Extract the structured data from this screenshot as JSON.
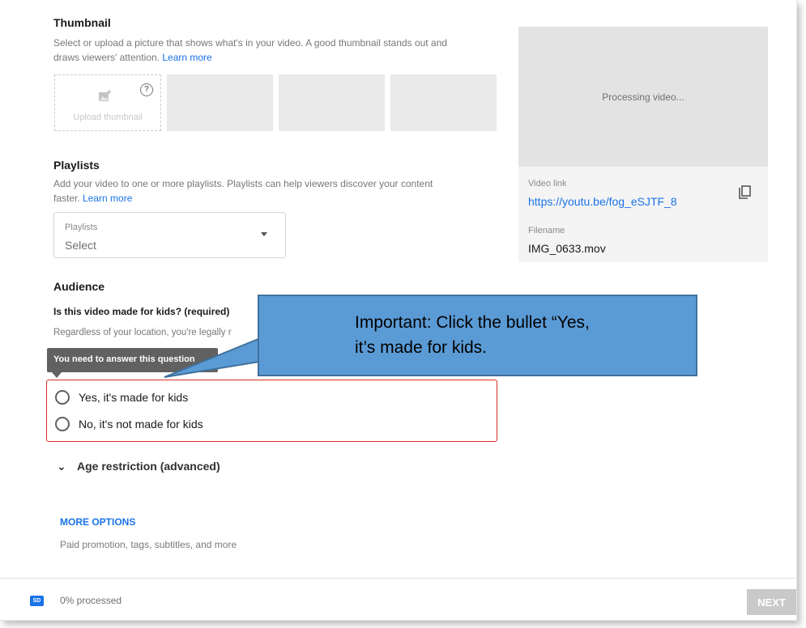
{
  "thumbnail": {
    "title": "Thumbnail",
    "desc_line1": "Select or upload a picture that shows what's in your video. A good thumbnail stands out and",
    "desc_line2": "draws viewers' attention.",
    "learn_more": "Learn more",
    "upload_label": "Upload thumbnail",
    "help_glyph": "?"
  },
  "playlists": {
    "title": "Playlists",
    "desc_line1": "Add your video to one or more playlists. Playlists can help viewers discover your content",
    "desc_line2": "faster.",
    "learn_more": "Learn more",
    "select_label": "Playlists",
    "select_value": "Select"
  },
  "preview": {
    "processing": "Processing video...",
    "video_link_label": "Video link",
    "video_link": "https://youtu.be/fog_eSJTF_8",
    "filename_label": "Filename",
    "filename": "IMG_0633.mov"
  },
  "audience": {
    "title": "Audience",
    "question": "Is this video made for kids? (required)",
    "desc_fragment": "Regardless of your location, you're legally r",
    "tooltip": "You need to answer this question",
    "options": [
      {
        "label": "Yes, it's made for kids",
        "checked": false
      },
      {
        "label": "No, it's not made for kids",
        "checked": false
      }
    ]
  },
  "callout": {
    "text_line1": "Important: Click the bullet “Yes,",
    "text_line2": "it’s made for kids."
  },
  "age_restriction": {
    "chevron": "⌄",
    "label": "Age restriction (advanced)"
  },
  "more_options": {
    "label": "MORE OPTIONS",
    "desc": "Paid promotion, tags, subtitles, and more"
  },
  "footer": {
    "badge": "SD",
    "progress_percent": 0,
    "processed": "0% processed",
    "next_label": "NEXT"
  }
}
